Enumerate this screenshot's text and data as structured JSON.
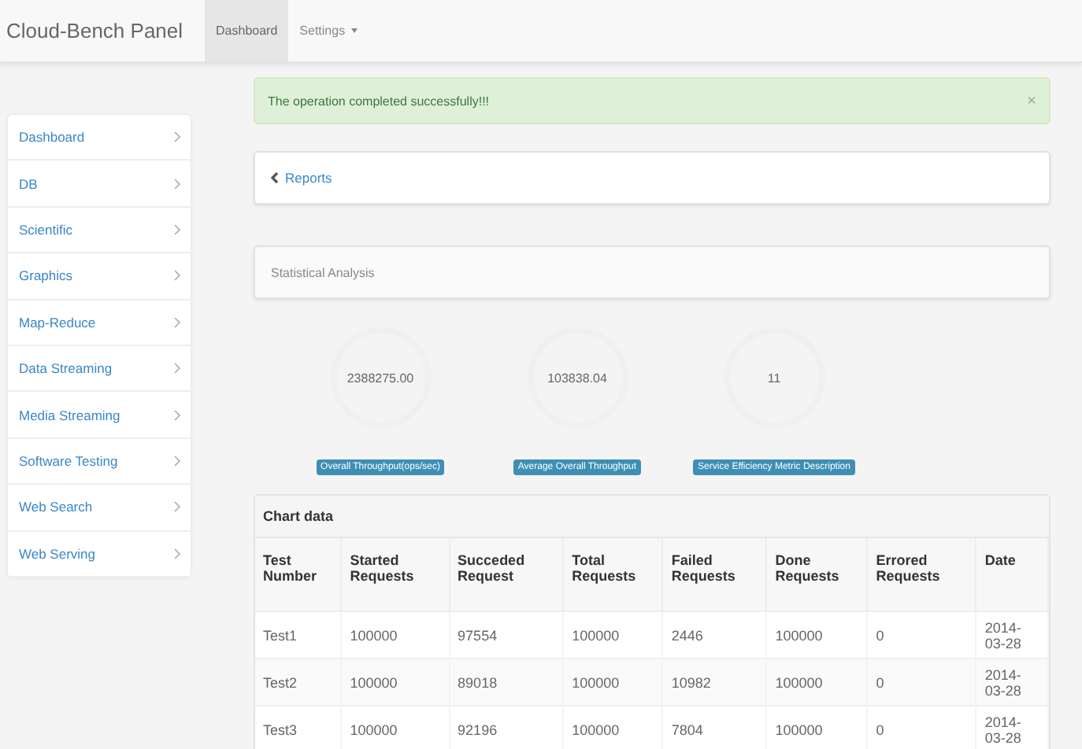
{
  "navbar": {
    "brand": "Cloud-Bench Panel",
    "tabs": [
      {
        "label": "Dashboard",
        "selected": true,
        "dropdown": false
      },
      {
        "label": "Settings",
        "selected": false,
        "dropdown": true
      }
    ]
  },
  "sidebar": {
    "items": [
      {
        "label": "Dashboard"
      },
      {
        "label": "DB"
      },
      {
        "label": "Scientific"
      },
      {
        "label": "Graphics"
      },
      {
        "label": "Map-Reduce"
      },
      {
        "label": "Data Streaming"
      },
      {
        "label": "Media Streaming"
      },
      {
        "label": "Software Testing"
      },
      {
        "label": "Web Search"
      },
      {
        "label": "Web Serving"
      }
    ]
  },
  "alert": {
    "text": "The operation completed successfully!!!",
    "close": "×"
  },
  "breadcrumb": {
    "label": "Reports"
  },
  "stats_panel": {
    "title": "Statistical Analysis"
  },
  "metrics": [
    {
      "value": "2388275.00",
      "label": "Overall Throughput(ops/sec)"
    },
    {
      "value": "103838.04",
      "label": "Average Overall Throughput"
    },
    {
      "value": "11",
      "label": "Service Efficiency Metric Description"
    }
  ],
  "table": {
    "title": "Chart data",
    "columns": [
      "Test Number",
      "Started Requests",
      "Succeded Request",
      "Total Requests",
      "Failed Requests",
      "Done Requests",
      "Errored Requests",
      "Date"
    ],
    "rows": [
      [
        "Test1",
        "100000",
        "97554",
        "100000",
        "2446",
        "100000",
        "0",
        "2014-03-28"
      ],
      [
        "Test2",
        "100000",
        "89018",
        "100000",
        "10982",
        "100000",
        "0",
        "2014-03-28"
      ],
      [
        "Test3",
        "100000",
        "92196",
        "100000",
        "7804",
        "100000",
        "0",
        "2014-03-28"
      ]
    ]
  }
}
